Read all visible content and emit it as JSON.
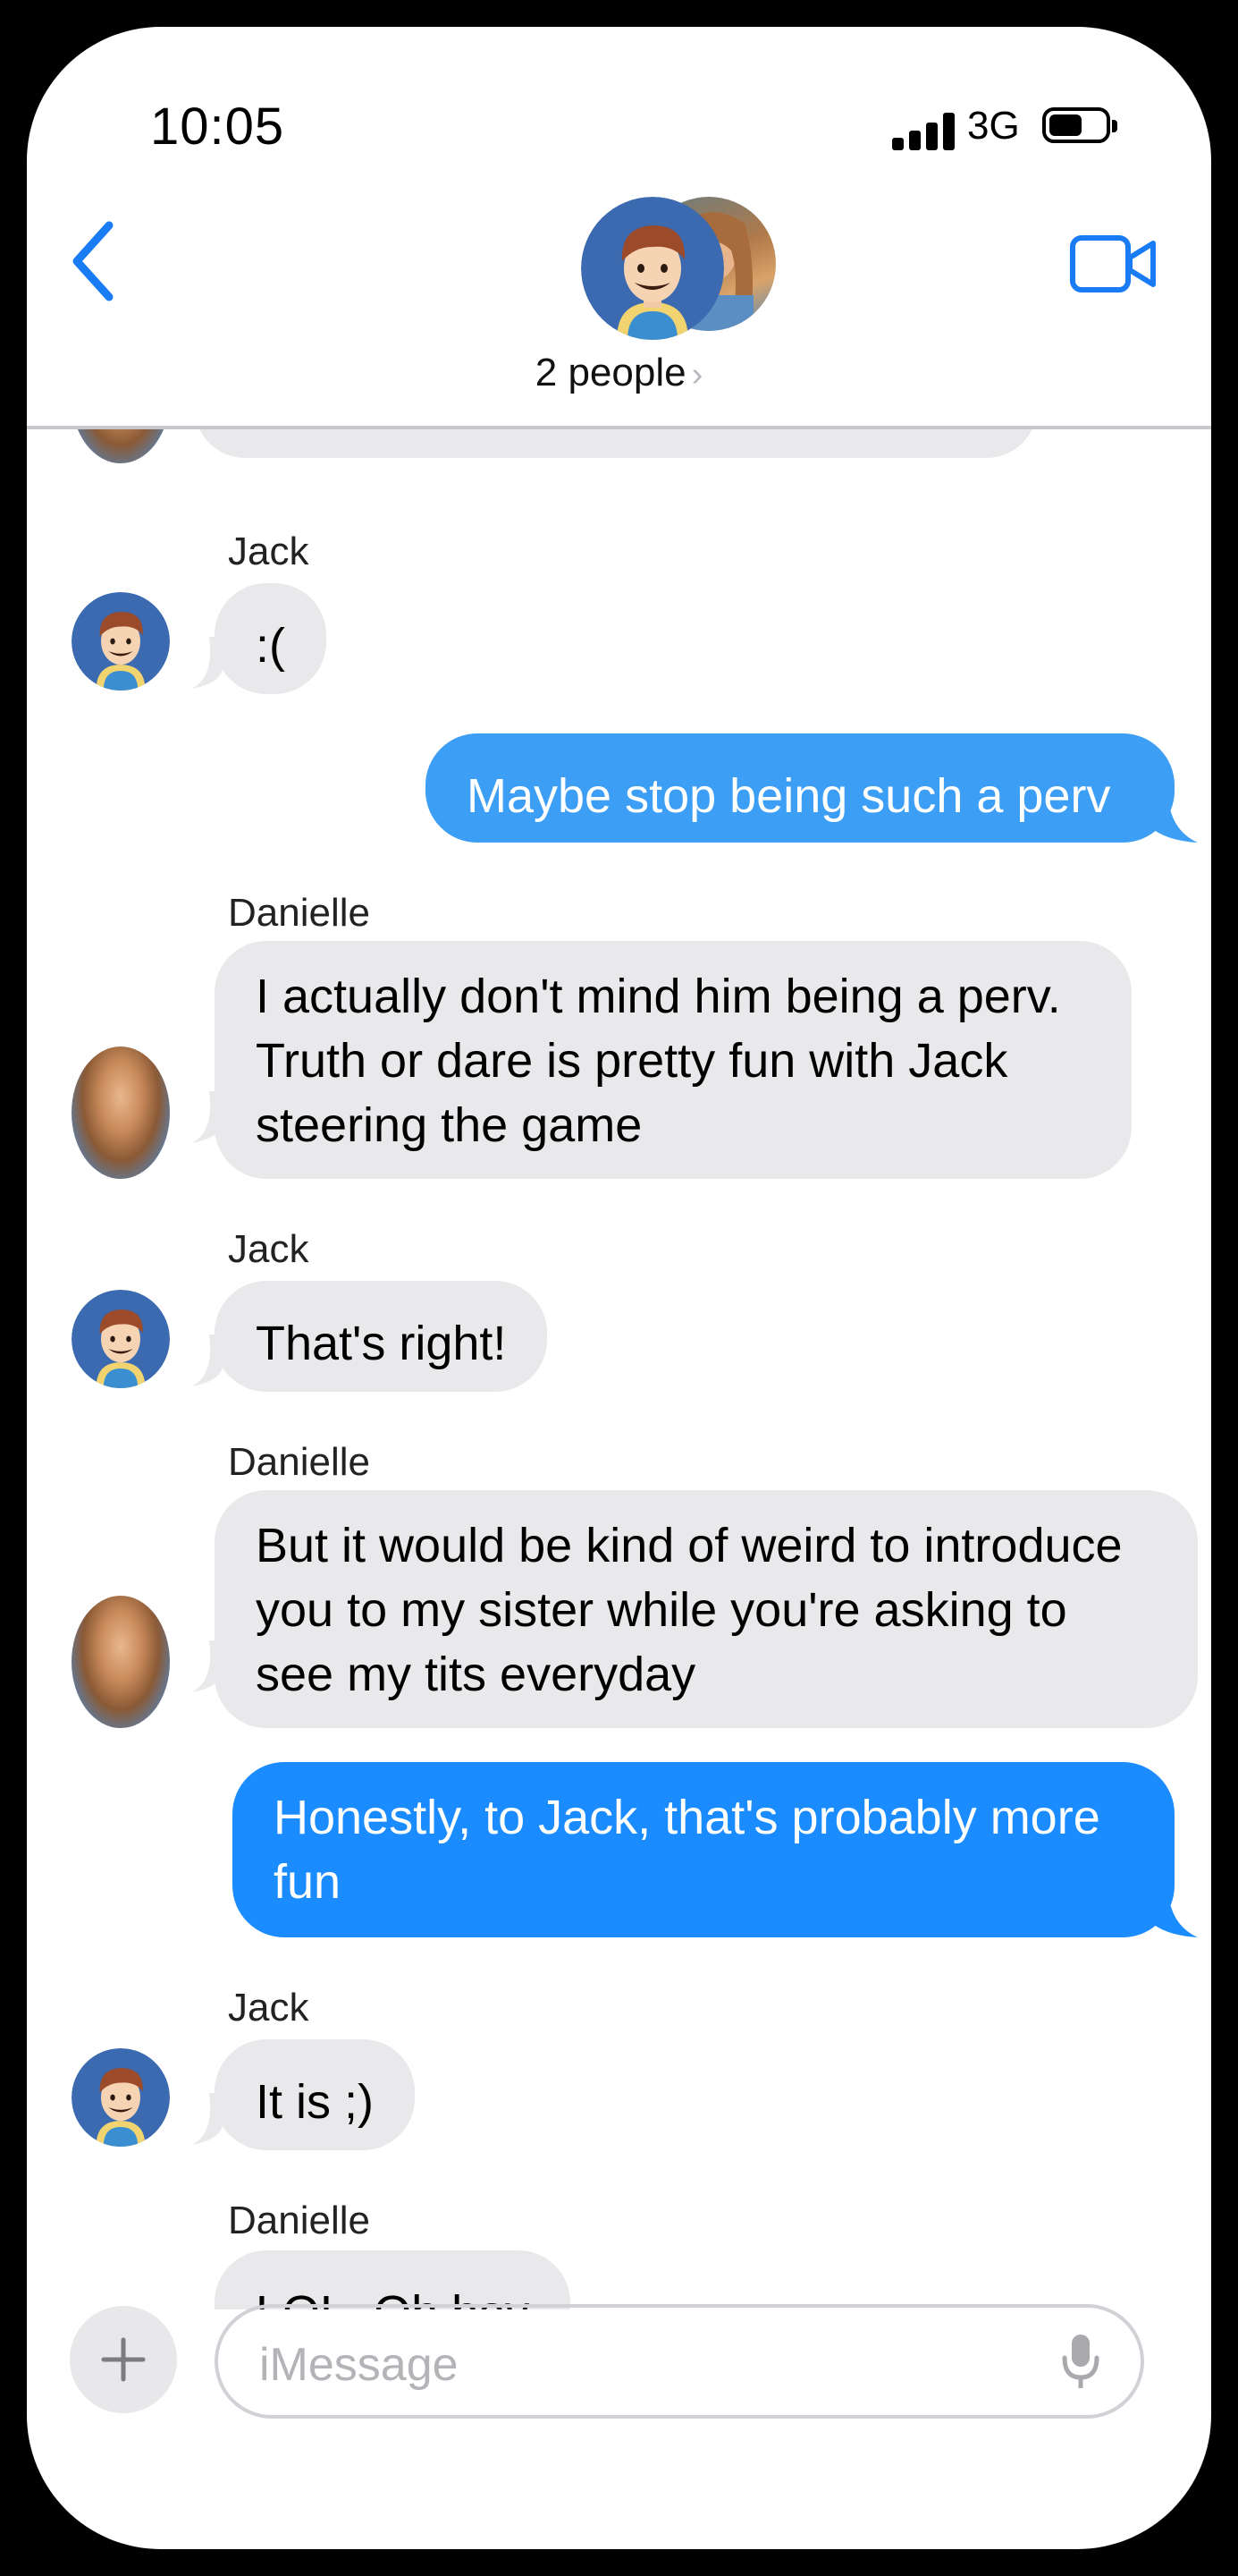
{
  "status_bar": {
    "time": "10:05",
    "network": "3G"
  },
  "header": {
    "group_label": "2 people",
    "chevron": "›"
  },
  "messages": [
    {
      "sender": "Jack",
      "text": ":(",
      "direction": "incoming"
    },
    {
      "text": "Maybe stop being such a perv",
      "direction": "outgoing"
    },
    {
      "sender": "Danielle",
      "lines": [
        "I actually don't mind him being a perv.",
        "Truth or dare is pretty fun with Jack",
        "steering the game"
      ],
      "direction": "incoming"
    },
    {
      "sender": "Jack",
      "text": "That's right!",
      "direction": "incoming"
    },
    {
      "sender": "Danielle",
      "lines": [
        "But it would be kind of weird to introduce",
        "you to my sister while you're asking to",
        "see my tits everyday"
      ],
      "direction": "incoming"
    },
    {
      "lines": [
        "Honestly, to Jack, that's probably more",
        "fun"
      ],
      "direction": "outgoing"
    },
    {
      "sender": "Jack",
      "text": "It is ;)",
      "direction": "incoming"
    },
    {
      "sender": "Danielle",
      "text": "LOL. Oh boy",
      "direction": "incoming"
    }
  ],
  "input": {
    "placeholder": "iMessage",
    "add_symbol": "+"
  },
  "colors": {
    "outgoing_bubble": "#1a8cff",
    "incoming_bubble": "#e9e9eb",
    "accent": "#1a7cf5"
  },
  "icons": [
    "back-chevron-icon",
    "video-call-icon",
    "plus-icon",
    "microphone-icon",
    "cellular-signal-icon",
    "battery-icon"
  ]
}
